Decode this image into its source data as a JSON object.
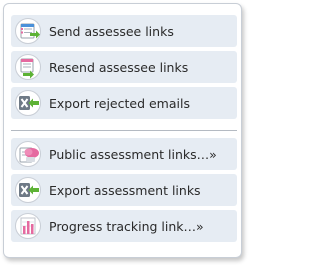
{
  "menu": {
    "items": [
      {
        "label": "Send assessee links",
        "icon": "send-links-icon"
      },
      {
        "label": "Resend assessee links",
        "icon": "resend-links-icon"
      },
      {
        "label": "Export rejected emails",
        "icon": "export-excel-icon"
      },
      {
        "label": "Public assessment links…»",
        "icon": "public-links-icon"
      },
      {
        "label": "Export assessment links",
        "icon": "export-excel-icon"
      },
      {
        "label": "Progress tracking link…»",
        "icon": "progress-chart-icon"
      }
    ]
  },
  "colors": {
    "item_background": "#e6ecf3",
    "green_arrow": "#5db235",
    "pink_accent": "#e56aa0"
  }
}
